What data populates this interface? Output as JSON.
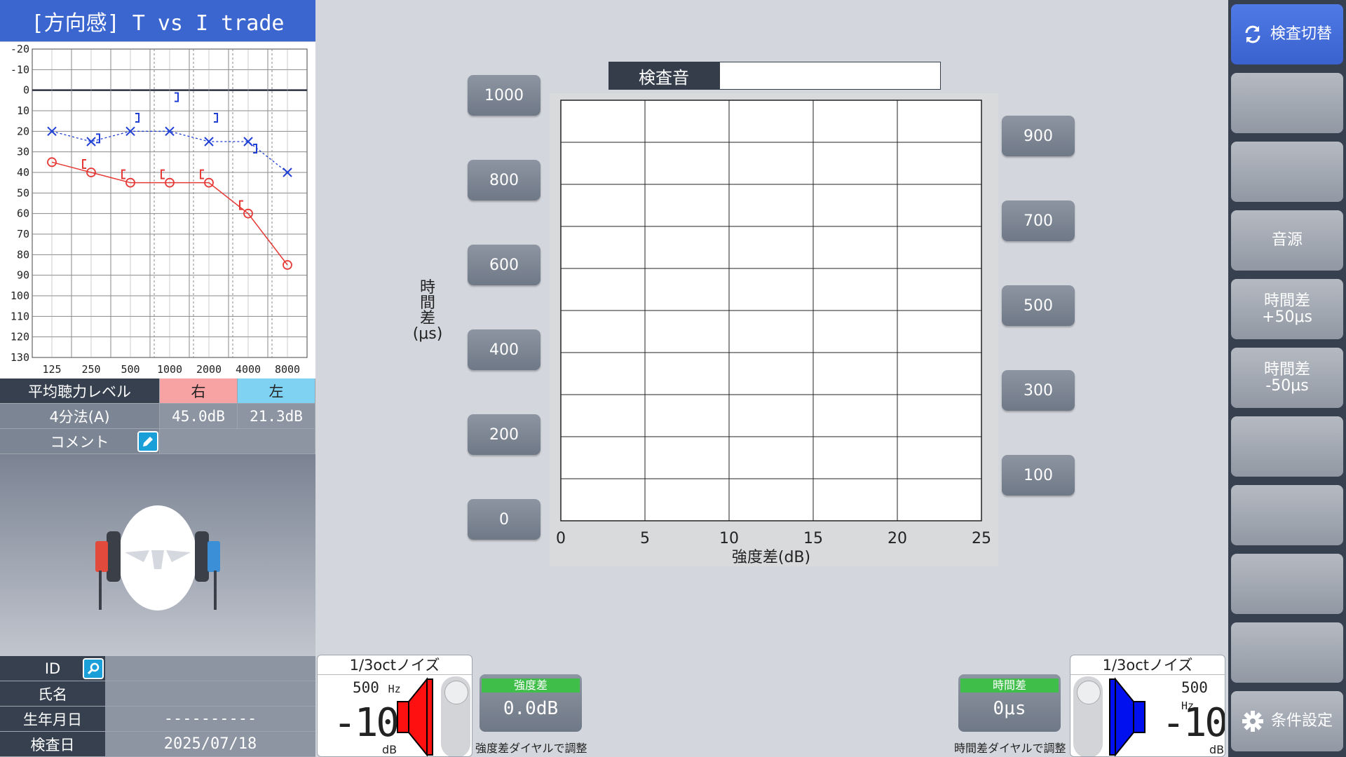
{
  "title": "[方向感] T vs I trade",
  "audiogram": {
    "y_ticks": [
      "-20",
      "-10",
      "0",
      "10",
      "20",
      "30",
      "40",
      "50",
      "60",
      "70",
      "80",
      "90",
      "100",
      "110",
      "120",
      "130"
    ],
    "x_ticks": [
      "125",
      "250",
      "500",
      "1000",
      "2000",
      "4000",
      "8000"
    ],
    "right_ac": [
      35,
      40,
      45,
      45,
      45,
      60,
      85
    ],
    "left_ac": [
      20,
      25,
      20,
      20,
      25,
      25,
      40
    ],
    "right_color": "#e53935",
    "left_color": "#1f3fd6"
  },
  "avg": {
    "header": "平均聴力レベル",
    "right": "右",
    "left": "左"
  },
  "fourbun": {
    "label": "4分法(A)",
    "right": "45.0dB",
    "left": "21.3dB"
  },
  "comment": {
    "label": "コメント"
  },
  "patient": {
    "id_label": "ID",
    "id_value": "",
    "name_label": "氏名",
    "name_value": "",
    "birth_label": "生年月日",
    "birth_value": "----------",
    "date_label": "検査日",
    "date_value": "2025/07/18"
  },
  "sidebar": [
    {
      "label": "検査切替",
      "icon": "refresh-icon",
      "active": true
    },
    {
      "label": ""
    },
    {
      "label": ""
    },
    {
      "label": "音源"
    },
    {
      "label1": "時間差",
      "label2": "+50μs"
    },
    {
      "label1": "時間差",
      "label2": "-50μs"
    },
    {
      "label": ""
    },
    {
      "label": ""
    },
    {
      "label": ""
    },
    {
      "label": ""
    },
    {
      "label": "条件設定",
      "icon": "gear-icon"
    }
  ],
  "left_buttons": [
    "1000",
    "800",
    "600",
    "400",
    "200",
    "0"
  ],
  "right_buttons": [
    "900",
    "700",
    "500",
    "300",
    "100"
  ],
  "ylabel": {
    "line1": "時",
    "line2": "間",
    "line3": "差",
    "line4": "(μs)"
  },
  "test_sound": {
    "label": "検査音",
    "value": ""
  },
  "chart_data": {
    "type": "scatter",
    "xlabel": "強度差(dB)",
    "x_ticks": [
      "0",
      "5",
      "10",
      "15",
      "20",
      "25"
    ],
    "xlim": [
      0,
      25
    ],
    "ylim": [
      0,
      1000
    ],
    "grid": true,
    "series": []
  },
  "right_signal": {
    "title": "1/3octノイズ",
    "freq": "500",
    "freq_unit": "Hz",
    "level": "-10",
    "unit": "dB",
    "color": "#ff0000"
  },
  "left_signal": {
    "title": "1/3octノイズ",
    "freq": "500",
    "freq_unit": "Hz",
    "level": "-10",
    "unit": "dB",
    "color": "#0000ee"
  },
  "intensity_adj": {
    "header": "強度差",
    "value": "0.0dB",
    "caption": "強度差ダイヤルで調整"
  },
  "time_adj": {
    "header": "時間差",
    "value": "0μs",
    "caption": "時間差ダイヤルで調整"
  }
}
